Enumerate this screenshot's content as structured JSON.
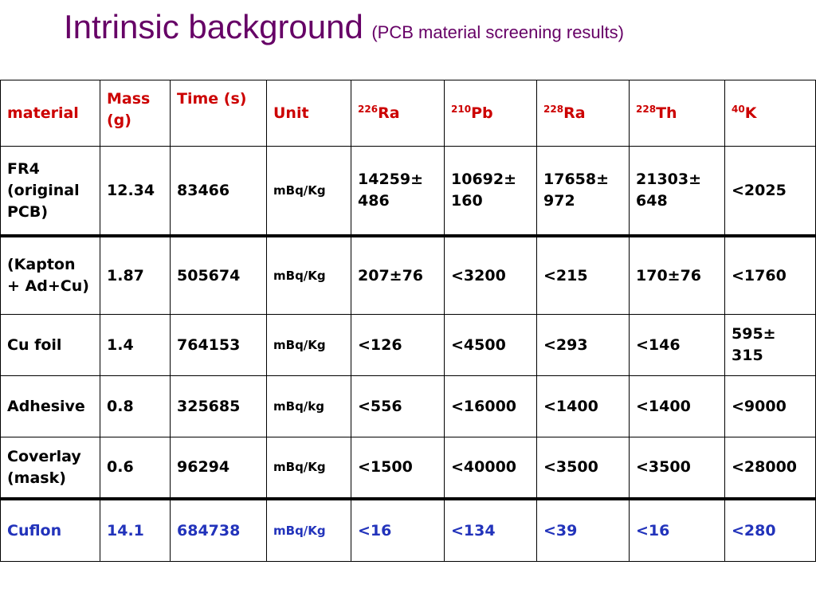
{
  "title": {
    "main": "Intrinsic background",
    "sub": "(PCB material screening results)"
  },
  "colors": {
    "title": "#660066",
    "header": "#cc0000",
    "highlight_row": "#2233bb",
    "text": "#000000"
  },
  "table": {
    "headers": {
      "material": "material",
      "mass": "Mass (g)",
      "time": "Time (s)",
      "unit": "Unit",
      "ra226_sup": "226",
      "ra226": "Ra",
      "pb210_sup": "210",
      "pb210": "Pb",
      "ra228_sup": "228",
      "ra228": "Ra",
      "th228_sup": "228",
      "th228": "Th",
      "k40_sup": "40",
      "k40": "K"
    },
    "rows": [
      {
        "material": "FR4 (original PCB)",
        "mass": "12.34",
        "time": "83466",
        "unit": "mBq/Kg",
        "ra226": "14259± 486",
        "pb210": "10692± 160",
        "ra228": "17658± 972",
        "th228": "21303± 648",
        "k40": "<2025"
      },
      {
        "material": "(Kapton + Ad+Cu)",
        "mass": "1.87",
        "time": "505674",
        "unit": "mBq/Kg",
        "ra226": "207±76",
        "pb210": "<3200",
        "ra228": "<215",
        "th228": "170±76",
        "k40": "<1760"
      },
      {
        "material": "Cu foil",
        "mass": "1.4",
        "time": "764153",
        "unit": "mBq/Kg",
        "ra226": "<126",
        "pb210": "<4500",
        "ra228": "<293",
        "th228": "<146",
        "k40": "595± 315"
      },
      {
        "material": "Adhesive",
        "mass": "0.8",
        "time": "325685",
        "unit": "mBq/kg",
        "ra226": "<556",
        "pb210": "<16000",
        "ra228": "<1400",
        "th228": "<1400",
        "k40": "<9000"
      },
      {
        "material": "Coverlay (mask)",
        "mass": "0.6",
        "time": "96294",
        "unit": "mBq/Kg",
        "ra226": "<1500",
        "pb210": "<40000",
        "ra228": "<3500",
        "th228": "<3500",
        "k40": "<28000"
      },
      {
        "material": "Cuflon",
        "mass": "14.1",
        "time": "684738",
        "unit": "mBq/Kg",
        "ra226": "<16",
        "pb210": "<134",
        "ra228": "<39",
        "th228": "<16",
        "k40": "<280"
      }
    ]
  }
}
